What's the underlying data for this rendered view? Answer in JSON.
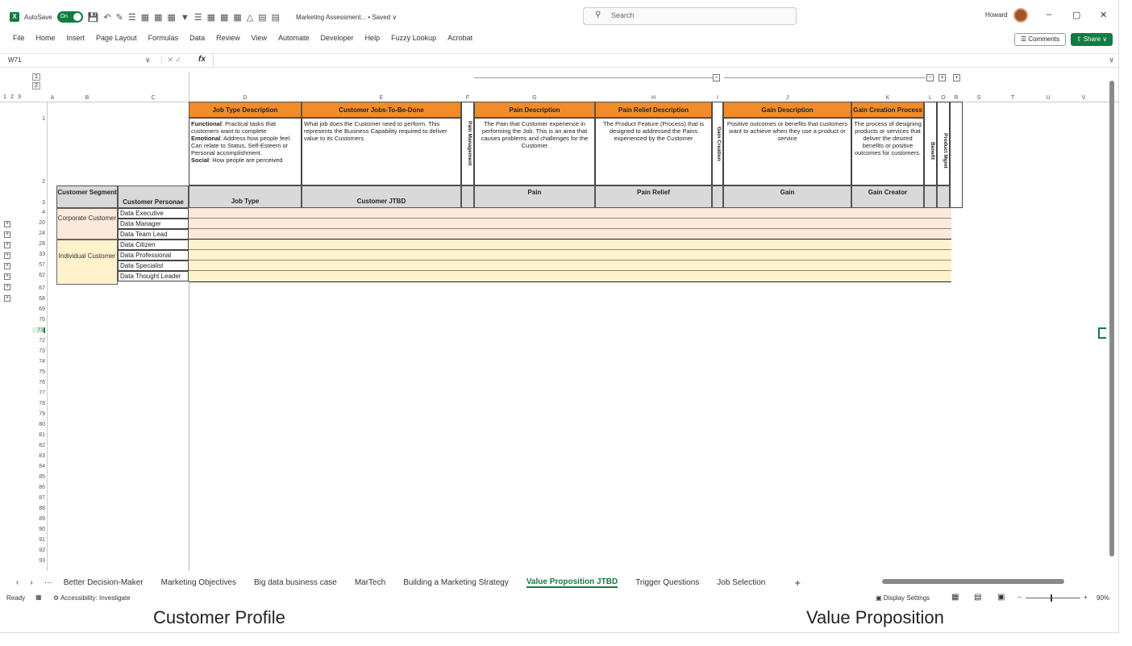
{
  "title_bar": {
    "autosave_label": "AutoSave",
    "autosave_state": "On",
    "doc_title": "Marketing Assessment... • Saved ∨",
    "search_placeholder": "Search",
    "user_name": "Howard",
    "minimize": "–",
    "restore": "▢",
    "close": "✕"
  },
  "menu": [
    "File",
    "Home",
    "Insert",
    "Page Layout",
    "Formulas",
    "Data",
    "Review",
    "View",
    "Automate",
    "Developer",
    "Help",
    "Fuzzy Lookup",
    "Acrobat"
  ],
  "buttons": {
    "comments": "☰ Comments",
    "share": "⇧ Share ∨"
  },
  "formula_bar": {
    "name_box": "W71",
    "fx": "fx",
    "content": ""
  },
  "outline_levels": [
    "1",
    "2",
    "3"
  ],
  "outline_rows": [
    "1",
    "2"
  ],
  "columns": [
    "A",
    "B",
    "C",
    "D",
    "E",
    "F",
    "G",
    "H",
    "I",
    "J",
    "K",
    "L",
    "O",
    "R",
    "S",
    "T",
    "U",
    "V"
  ],
  "headers": {
    "job_type_desc": "Job Type Description",
    "customer_jtbd": "Customer Jobs-To-Be-Done",
    "pain_desc": "Pain Description",
    "pain_relief_desc": "Pain Relief Description",
    "gain_desc": "Gain Description",
    "gain_creation": "Gain Creation Process",
    "pain_mgmt_vert": "Pain Management",
    "gain_creation_vert": "Gain Creation",
    "benefit_vert": "Benefit",
    "product_mgmt_vert": "Product Mgmt"
  },
  "descriptions": {
    "job_type": {
      "functional_label": "Functional",
      "functional": ": Practical tasks that customers want to complete",
      "emotional_label": "Emotional",
      "emotional": ": Address how people feel. Can relate to Status, Self-Esteem or Personal accomplishment.",
      "social_label": "Social",
      "social": ": How people are perceived"
    },
    "jtbd": "What job does the Customer need to perform. This represents the Business Capability required to deliver value to its Customers",
    "pain": "The Pain that Customer experience in performing the Job. This is an area that causes problems and challenges for the Customer",
    "pain_relief": "The Product Feature (Process) that is designed to addressed the Pains experienced by the Customer",
    "gain": "Positive outcomes or benefits that customers want to achieve when they use a product or service",
    "gain_creation": "The process of designing products or services that deliver the desired benefits or positive outcomes for customers."
  },
  "row3": {
    "segment": "Customer Segment",
    "personae": "Customer Personae",
    "job_type": "Job Type",
    "jtbd": "Customer JTBD",
    "pain": "Pain",
    "pain_relief": "Pain Relief",
    "gain": "Gain",
    "gain_creator": "Gain Creator"
  },
  "segments": [
    "Corporate Customer",
    "Individual Customer"
  ],
  "personas": [
    {
      "row": "4",
      "name": "Data Executive"
    },
    {
      "row": "20",
      "name": "Data Manager"
    },
    {
      "row": "24",
      "name": "Data Team Lead"
    },
    {
      "row": "28",
      "name": "Data Citizen"
    },
    {
      "row": "33",
      "name": "Data Professional"
    },
    {
      "row": "57",
      "name": "Data Specialist"
    },
    {
      "row": "62",
      "name": "Data Thought Leader"
    }
  ],
  "header_rows": [
    "1",
    "2",
    "3"
  ],
  "empty_rows": [
    "67",
    "68",
    "69",
    "70",
    "71",
    "72",
    "73",
    "74",
    "75",
    "76",
    "77",
    "78",
    "79",
    "80",
    "81",
    "82",
    "83",
    "84",
    "85",
    "86",
    "87",
    "88",
    "89",
    "90",
    "91",
    "92",
    "93"
  ],
  "sheet_tabs": [
    "Better Decision-Maker",
    "Marketing Objectives",
    "Big data business case",
    "MarTech",
    "Building a Marketing Strategy",
    "Value Proposition JTBD",
    "Trigger Questions",
    "Job Selection"
  ],
  "active_tab": "Value Proposition JTBD",
  "status": {
    "ready": "Ready",
    "accessibility": "Accessibility: Investigate",
    "display_settings": "Display Settings",
    "zoom": "90%"
  },
  "captions": {
    "left": "Customer Profile",
    "right": "Value Proposition"
  },
  "colors": {
    "excel_green": "#107c41",
    "orange_header": "#f28c28",
    "corporate_fill": "#fde9d9",
    "individual_fill": "#fff2cc"
  }
}
